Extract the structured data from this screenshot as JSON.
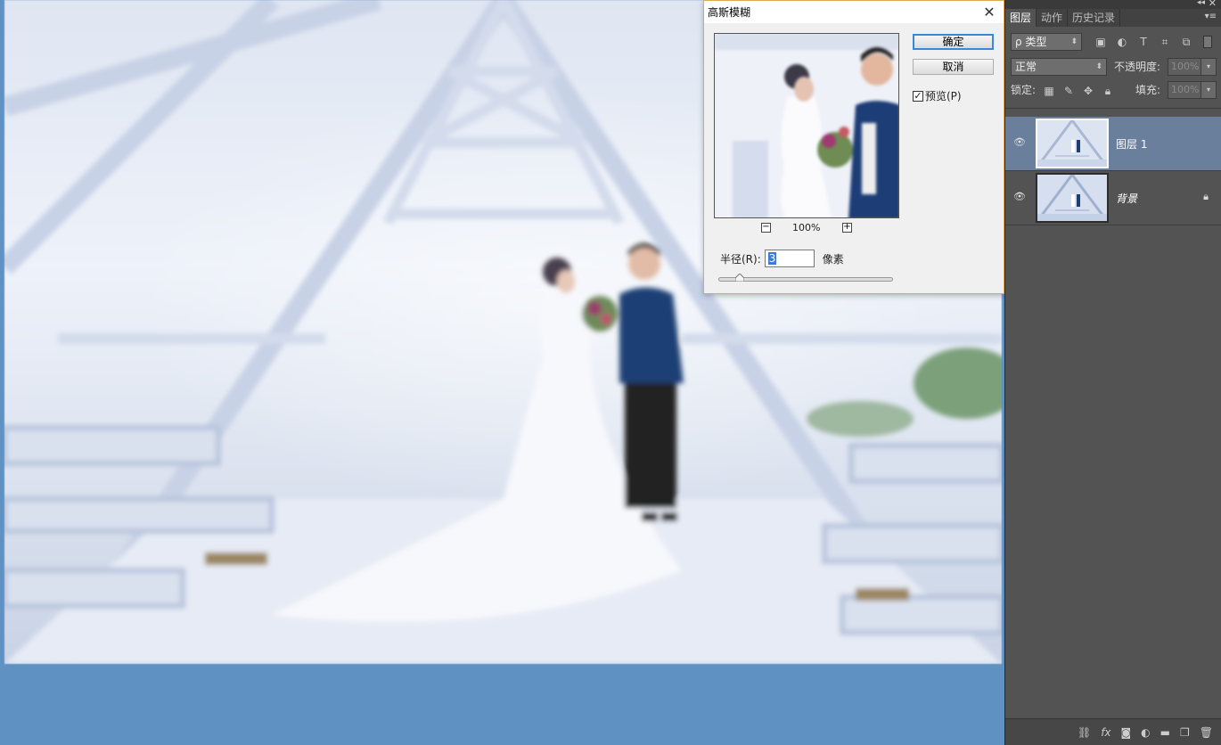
{
  "dialog": {
    "title": "高斯模糊",
    "ok_label": "确定",
    "cancel_label": "取消",
    "preview_label": "预览(P)",
    "preview_checked": true,
    "zoom": "100%",
    "radius_label": "半径(R):",
    "radius_value": "3",
    "unit": "像素",
    "radius_slider_fraction": 0.12
  },
  "panel": {
    "tabs": [
      {
        "label": "图层",
        "active": true
      },
      {
        "label": "动作",
        "active": false
      },
      {
        "label": "历史记录",
        "active": false
      }
    ],
    "filter_kind": "ρ 类型",
    "blend_mode": "正常",
    "opacity_label": "不透明度:",
    "opacity_value": "100%",
    "lock_label": "锁定:",
    "fill_label": "填充:",
    "fill_value": "100%",
    "layers": [
      {
        "name": "图层 1",
        "active": true,
        "locked": false
      },
      {
        "name": "背景",
        "active": false,
        "locked": true
      }
    ]
  },
  "colors": {
    "workspace": "#5f91c3",
    "panel": "#535353",
    "active_layer": "#6a7f9b",
    "ok_focus": "#3b88d8"
  },
  "icons": [
    "link-icon",
    "fx-icon",
    "mask-icon",
    "adjustment-icon",
    "group-folder-icon",
    "new-layer-icon",
    "trash-icon"
  ]
}
